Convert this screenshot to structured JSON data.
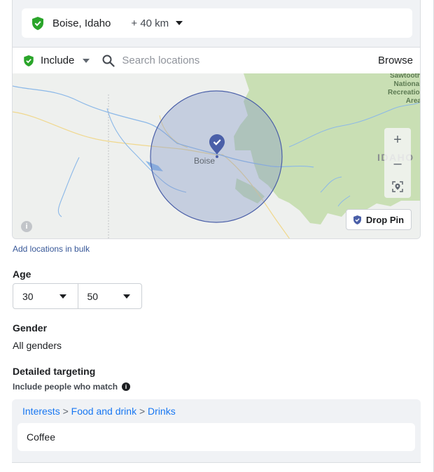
{
  "location": {
    "selected_name": "Boise, Idaho",
    "radius": "+ 40 km",
    "include_label": "Include",
    "search_placeholder": "Search locations",
    "browse_label": "Browse",
    "map": {
      "city_label": "Boise",
      "state_label": "IDAHO",
      "area_label": "Sawtooth National Recreation Area",
      "zoom_in": "+",
      "zoom_out": "–",
      "drop_pin_label": "Drop Pin",
      "info_glyph": "i"
    },
    "bulk_link": "Add locations in bulk"
  },
  "age": {
    "label": "Age",
    "min": "30",
    "max": "50"
  },
  "gender": {
    "label": "Gender",
    "value": "All genders"
  },
  "detailed_targeting": {
    "label": "Detailed targeting",
    "sublabel": "Include people who match",
    "info_glyph": "i",
    "breadcrumb": [
      "Interests",
      "Food and drink",
      "Drinks"
    ],
    "separator": ">",
    "selected_interest": "Coffee"
  },
  "colors": {
    "include_green": "#2aa52a",
    "link_blue": "#1877f2",
    "pin_blue": "#4a5fa8"
  },
  "icons": [
    "shield-check-icon",
    "caret-down-icon",
    "search-icon",
    "map-pin-icon",
    "locate-icon",
    "info-icon"
  ]
}
